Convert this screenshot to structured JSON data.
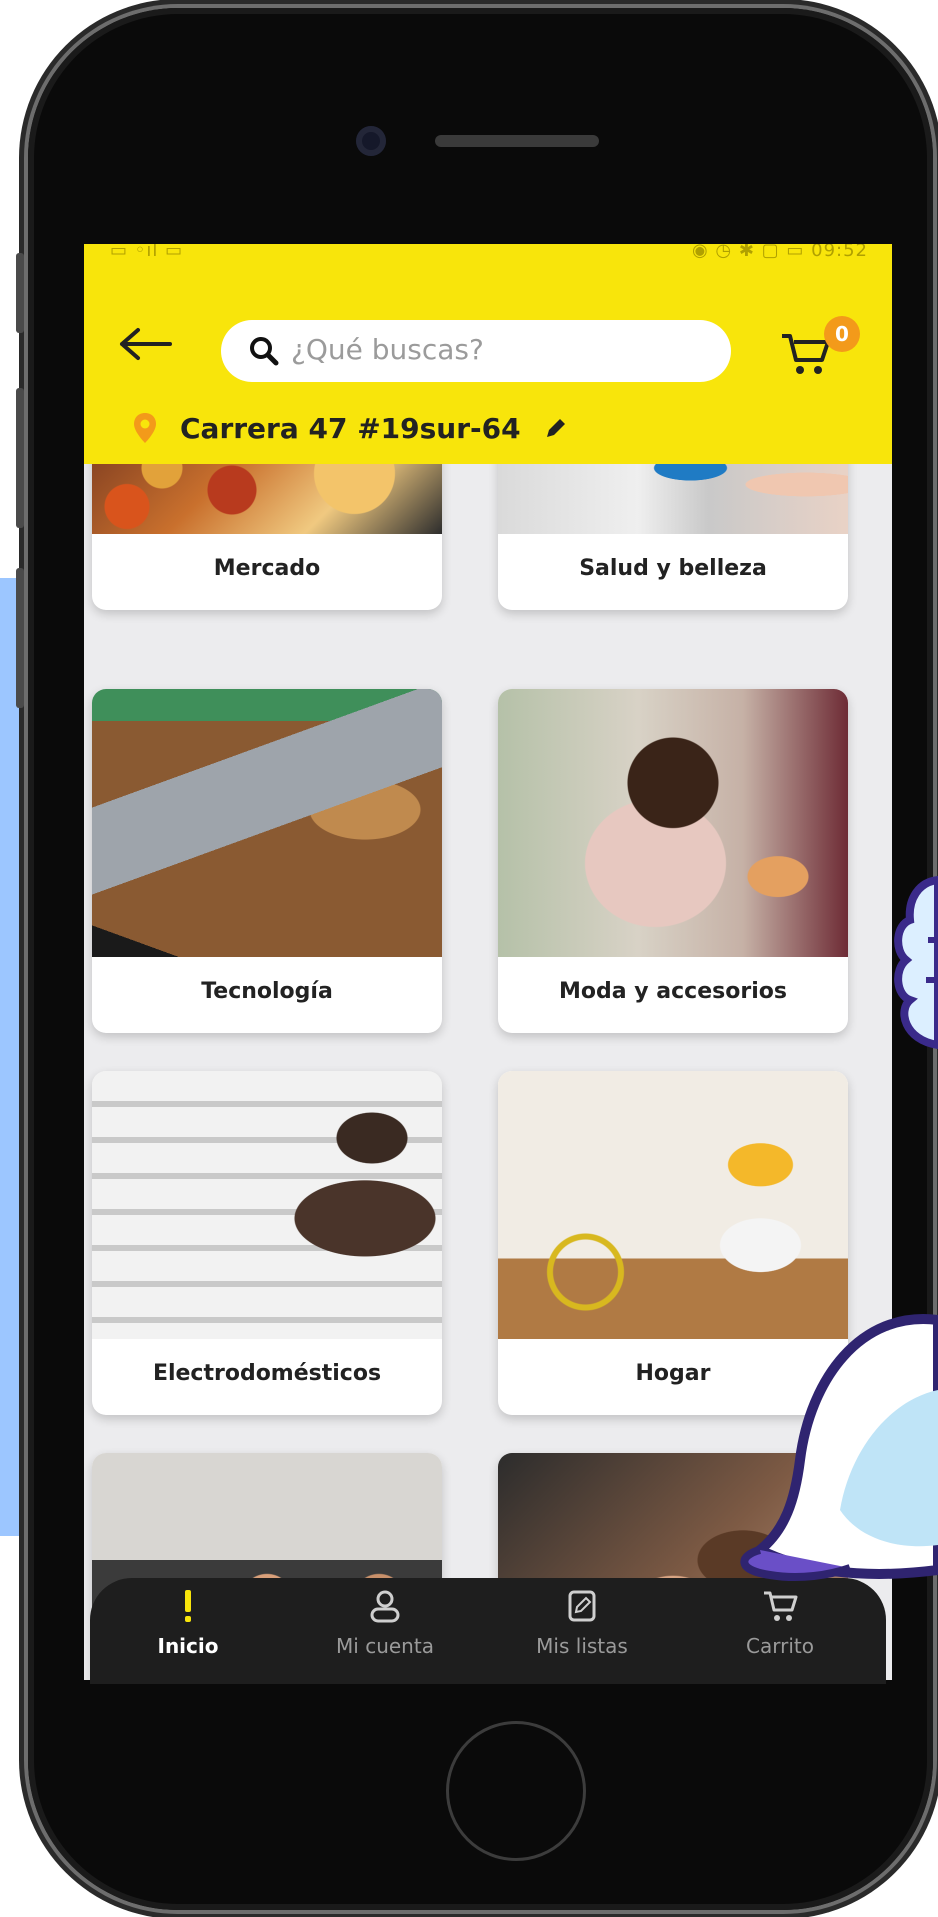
{
  "header": {
    "search_placeholder": "¿Qué buscas?",
    "cart_count": "0",
    "address": "Carrera 47 #19sur-64"
  },
  "categories": [
    {
      "label": "Mercado"
    },
    {
      "label": "Salud y belleza"
    },
    {
      "label": "Tecnología"
    },
    {
      "label": "Moda y accesorios"
    },
    {
      "label": "Electrodomésticos"
    },
    {
      "label": "Hogar"
    }
  ],
  "bottom_nav": {
    "items": [
      {
        "label": "Inicio",
        "icon": "exclamation-icon",
        "active": true
      },
      {
        "label": "Mi cuenta",
        "icon": "user-icon",
        "active": false
      },
      {
        "label": "Mis listas",
        "icon": "list-edit-icon",
        "active": false
      },
      {
        "label": "Carrito",
        "icon": "cart-icon",
        "active": false
      }
    ]
  },
  "colors": {
    "header_yellow": "#f8e50b",
    "badge_orange": "#f39a1a",
    "nav_bg": "#1e1e1e",
    "side_panel_blue": "#9cc6ff"
  }
}
